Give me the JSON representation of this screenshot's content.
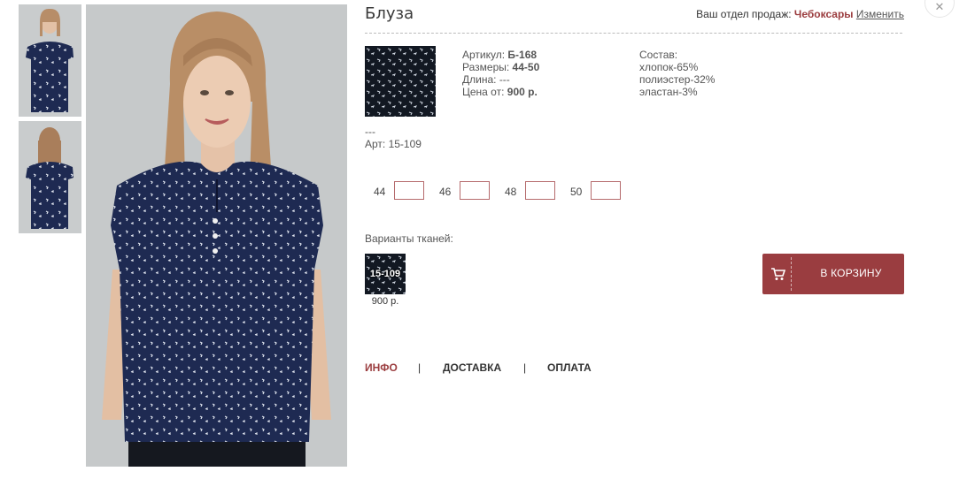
{
  "product": {
    "title": "Блуза",
    "article_label": "Артикул:",
    "article_value": "Б-168",
    "sizes_label": "Размеры:",
    "sizes_value": "44-50",
    "length_label": "Длина:",
    "length_value": "---",
    "price_label": "Цена от:",
    "price_value": "900 р.",
    "composition_title": "Состав:",
    "composition": [
      "хлопок-65%",
      "полиэстер-32%",
      "эластан-3%"
    ],
    "desc_line": "---",
    "art_line": "Арт: 15-109"
  },
  "header": {
    "dept_label": "Ваш отдел продаж:",
    "dept_city": "Чебоксары",
    "change_label": "Изменить"
  },
  "sizes": [
    {
      "label": "44",
      "value": ""
    },
    {
      "label": "46",
      "value": ""
    },
    {
      "label": "48",
      "value": ""
    },
    {
      "label": "50",
      "value": ""
    }
  ],
  "fabric": {
    "label": "Варианты тканей:",
    "code": "15-109",
    "price": "900 р."
  },
  "cart": {
    "label": "В КОРЗИНУ"
  },
  "tabs": [
    {
      "label": "ИНФО",
      "active": true
    },
    {
      "label": "ДОСТАВКА",
      "active": false
    },
    {
      "label": "ОПЛАТА",
      "active": false
    }
  ],
  "tab_separator": "|",
  "icons": {
    "cart": "shopping-cart-icon",
    "close": "close-icon"
  },
  "colors": {
    "accent": "#9a3d40",
    "fabric": "#121822",
    "blouse": "#1e2a52"
  }
}
